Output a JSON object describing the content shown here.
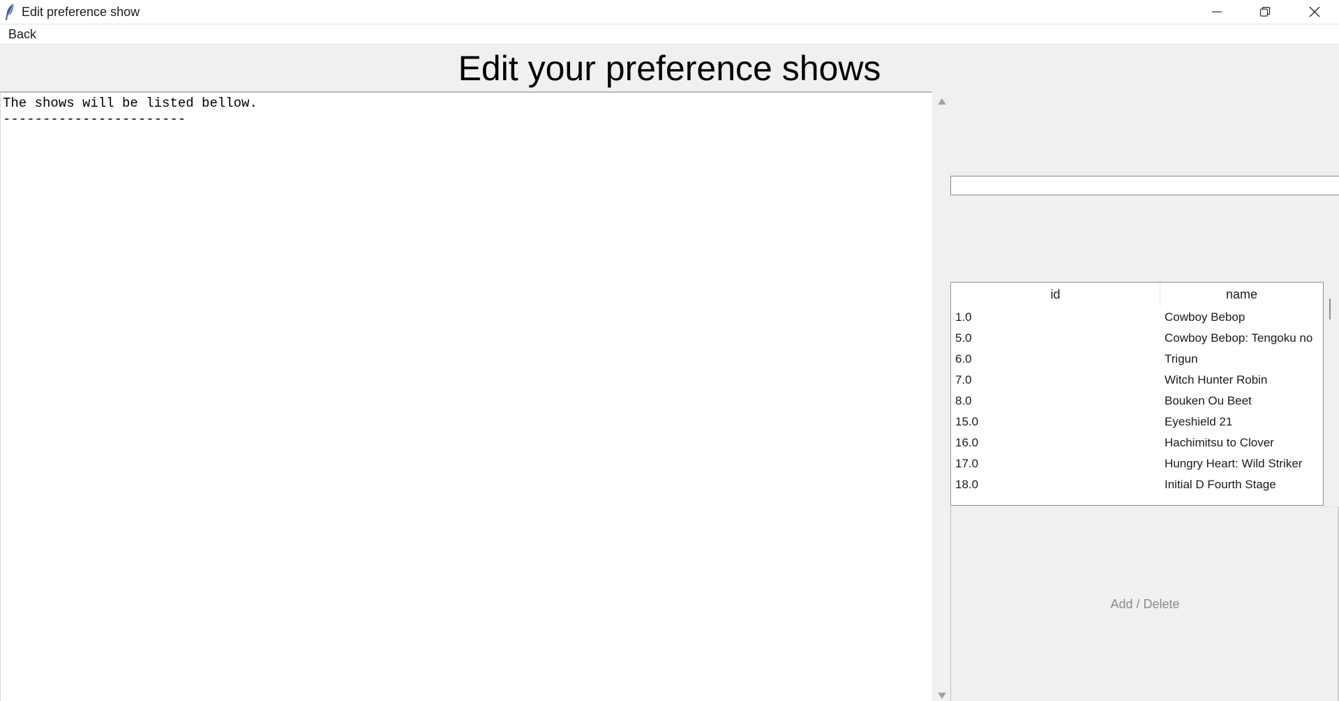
{
  "window": {
    "title": "Edit preference show",
    "icon": "feather-icon"
  },
  "menu": {
    "back_label": "Back"
  },
  "heading": "Edit your preference shows",
  "textarea": {
    "lines": [
      "The shows will be listed bellow.",
      "-----------------------"
    ]
  },
  "search": {
    "value": ""
  },
  "table": {
    "columns": [
      "id",
      "name"
    ],
    "rows": [
      {
        "id": "1.0",
        "name": "Cowboy Bebop"
      },
      {
        "id": "5.0",
        "name": "Cowboy Bebop: Tengoku no"
      },
      {
        "id": "6.0",
        "name": "Trigun"
      },
      {
        "id": "7.0",
        "name": "Witch Hunter Robin"
      },
      {
        "id": "8.0",
        "name": "Bouken Ou Beet"
      },
      {
        "id": "15.0",
        "name": "Eyeshield 21"
      },
      {
        "id": "16.0",
        "name": "Hachimitsu to Clover"
      },
      {
        "id": "17.0",
        "name": "Hungry Heart: Wild Striker"
      },
      {
        "id": "18.0",
        "name": "Initial D Fourth Stage"
      }
    ]
  },
  "actions": {
    "add_delete_label": "Add / Delete"
  },
  "colors": {
    "background": "#f0f0f0",
    "button_text_disabled": "#8b8b8b"
  }
}
